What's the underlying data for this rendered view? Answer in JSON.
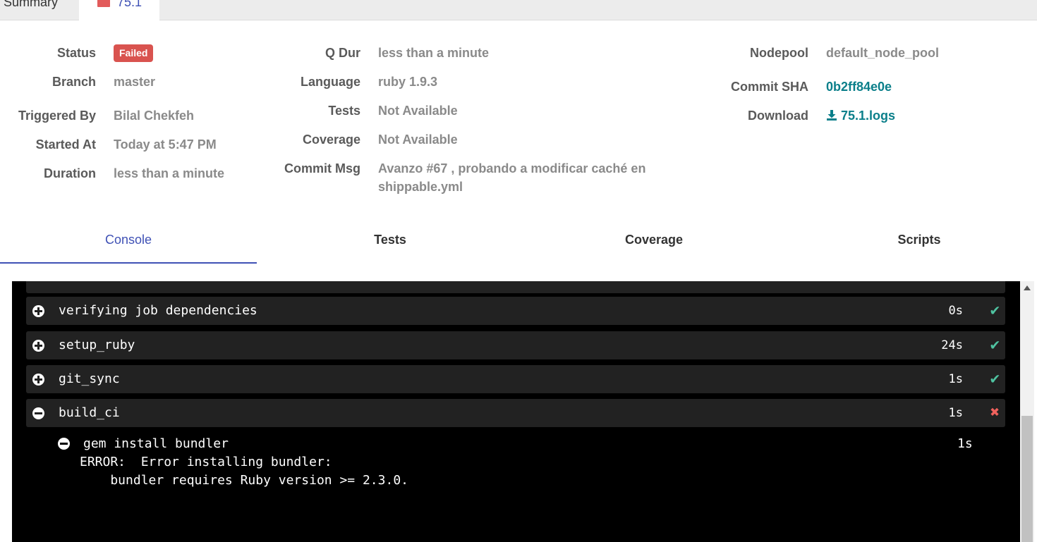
{
  "top_tabs": {
    "summary": "Summary",
    "build": "75.1"
  },
  "details": {
    "status_label": "Status",
    "status_value": "Failed",
    "branch_label": "Branch",
    "branch_value": "master",
    "triggered_label": "Triggered By",
    "triggered_value": "Bilal Chekfeh",
    "started_label": "Started At",
    "started_value": "Today at 5:47 PM",
    "duration_label": "Duration",
    "duration_value": "less than a minute",
    "qdur_label": "Q Dur",
    "qdur_value": "less than a minute",
    "language_label": "Language",
    "language_value": "ruby 1.9.3",
    "tests_label": "Tests",
    "tests_value": "Not Available",
    "coverage_label": "Coverage",
    "coverage_value": "Not Available",
    "commitmsg_label": "Commit Msg",
    "commitmsg_value": "Avanzo #67 , probando a modificar caché en shippable.yml",
    "nodepool_label": "Nodepool",
    "nodepool_value": "default_node_pool",
    "sha_label": "Commit SHA",
    "sha_value": "0b2ff84e0e",
    "download_label": "Download",
    "download_value": "75.1.logs"
  },
  "tabs": [
    "Console",
    "Tests",
    "Coverage",
    "Scripts"
  ],
  "console": {
    "steps": [
      {
        "name": "verifying job dependencies",
        "duration": "0s",
        "status": "success"
      },
      {
        "name": "setup_ruby",
        "duration": "24s",
        "status": "success"
      },
      {
        "name": "git_sync",
        "duration": "1s",
        "status": "success"
      },
      {
        "name": "build_ci",
        "duration": "1s",
        "status": "failed"
      }
    ],
    "sub_step": {
      "name": "gem install bundler",
      "duration": "1s"
    },
    "output": [
      "ERROR:  Error installing bundler:",
      "    bundler requires Ruby version >= 2.3.0."
    ]
  },
  "colors": {
    "failed_badge": "#d9534f",
    "success": "#4fc3a1",
    "fail": "#f0625d",
    "accent": "#3f51b5",
    "link": "#0b7f8a"
  }
}
